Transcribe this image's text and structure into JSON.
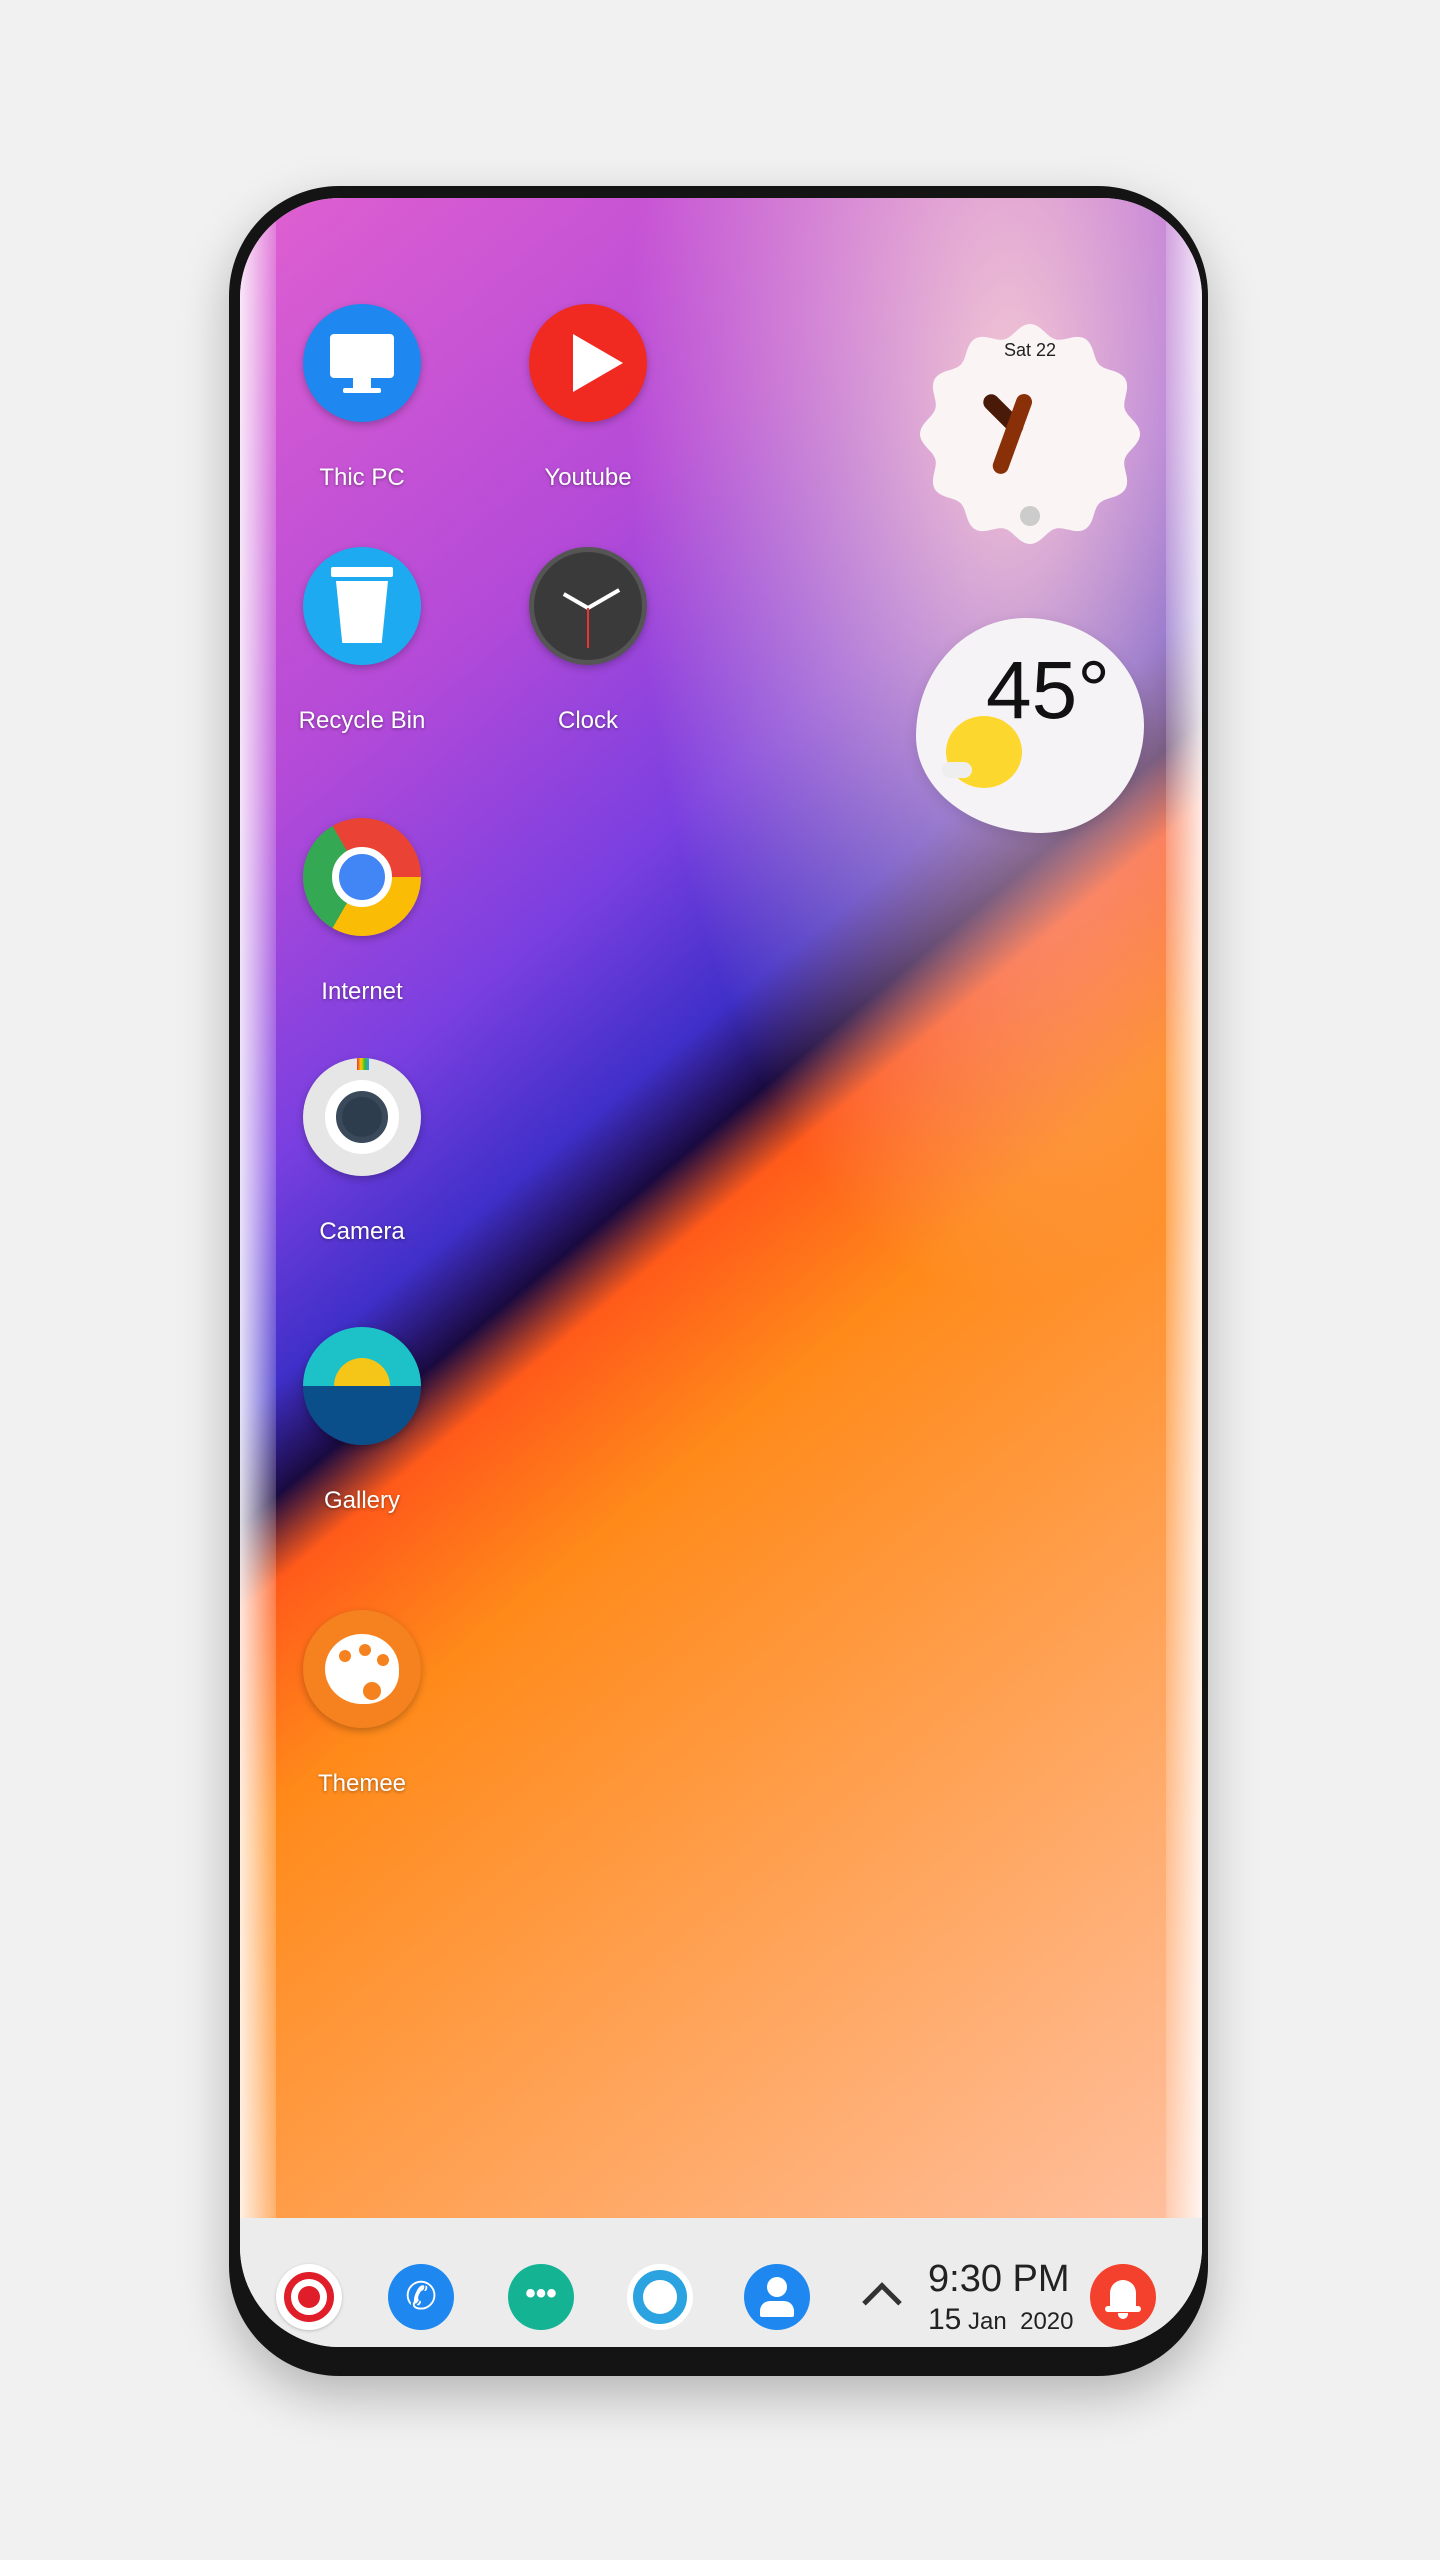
{
  "desktop": {
    "apps": [
      {
        "label": "Thic PC",
        "icon": "monitor-icon"
      },
      {
        "label": "Youtube",
        "icon": "play-icon"
      },
      {
        "label": "Recycle Bin",
        "icon": "trash-icon"
      },
      {
        "label": "Clock",
        "icon": "clock-icon"
      },
      {
        "label": "Internet",
        "icon": "chrome-icon"
      },
      {
        "label": "Camera",
        "icon": "camera-icon"
      },
      {
        "label": "Gallery",
        "icon": "gallery-icon"
      },
      {
        "label": "Themee",
        "icon": "palette-icon"
      }
    ]
  },
  "widgets": {
    "clock": {
      "date": "Sat 22"
    },
    "weather": {
      "temperature": "45°",
      "condition_icon": "sun-cloud-icon"
    }
  },
  "taskbar": {
    "icons": [
      "start-icon",
      "phone-icon",
      "messages-icon",
      "cortana-icon",
      "contacts-icon"
    ],
    "time": "9:30 PM",
    "day": "15",
    "month": "Jan",
    "year": "2020",
    "notification_icon": "bell-icon"
  }
}
